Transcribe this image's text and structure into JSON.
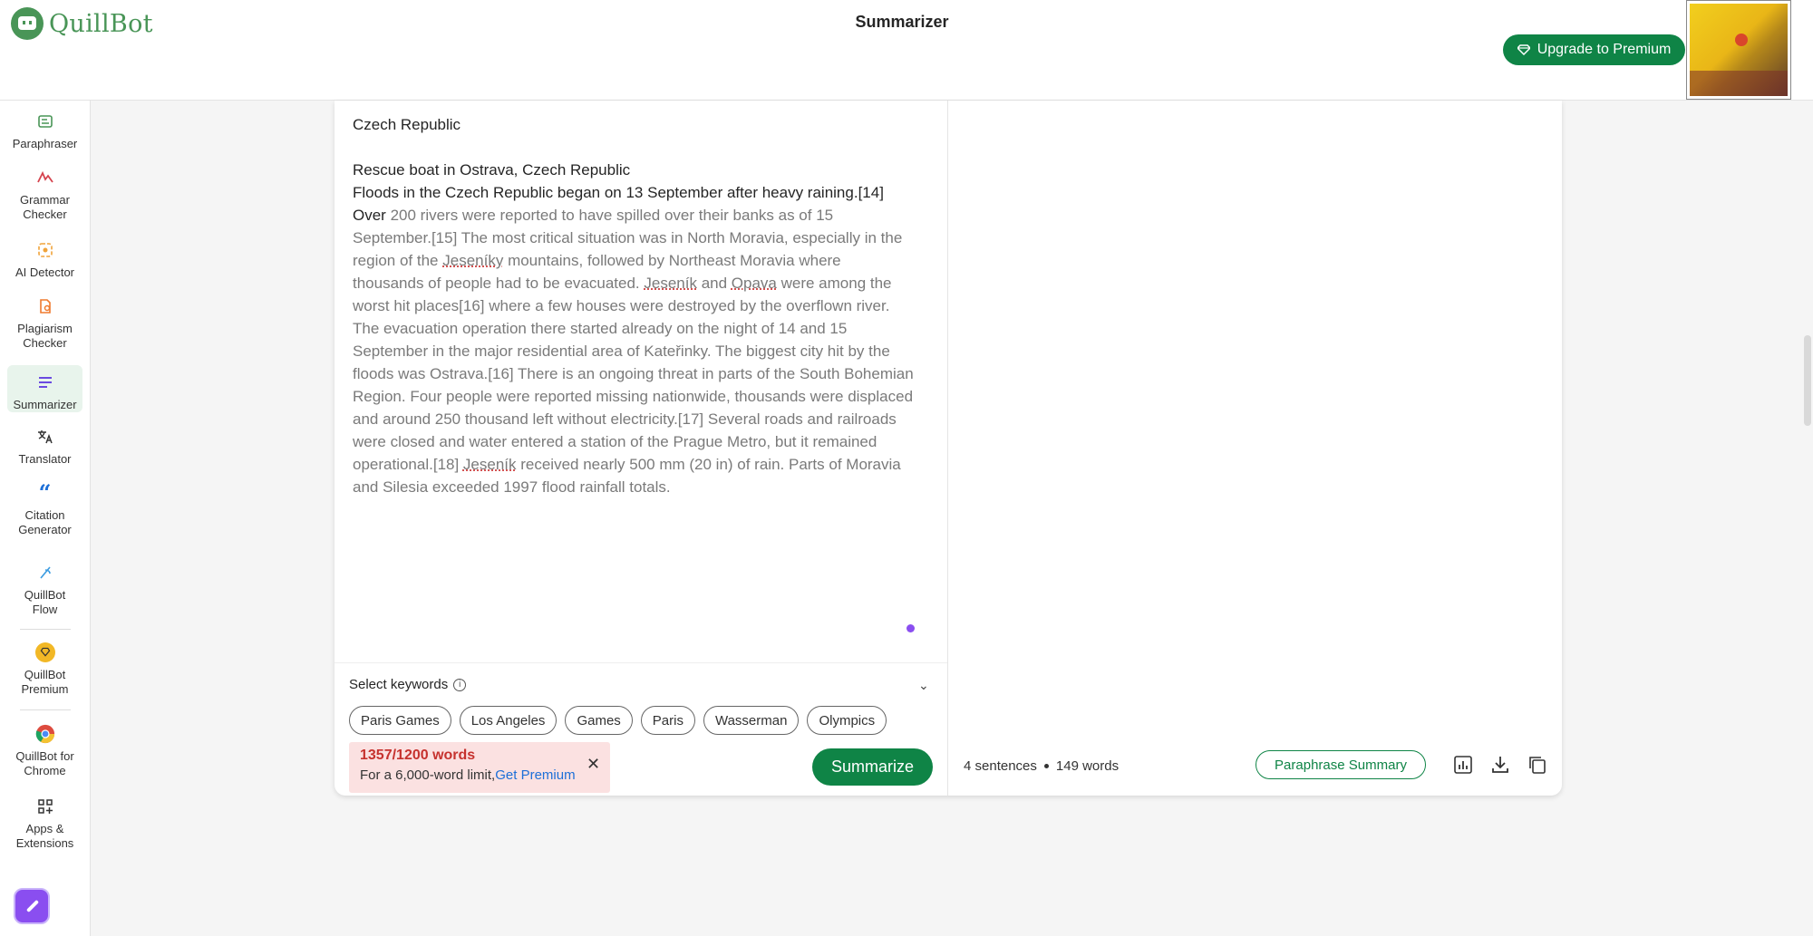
{
  "app": {
    "brand": "QuillBot",
    "page_title": "Summarizer",
    "upgrade_label": "Upgrade to Premium"
  },
  "sidebar": {
    "items": [
      {
        "label": "Paraphraser",
        "icon": "paraphraser-icon"
      },
      {
        "label": "Grammar Checker",
        "icon": "grammar-icon"
      },
      {
        "label": "AI Detector",
        "icon": "ai-detector-icon"
      },
      {
        "label": "Plagiarism Checker",
        "icon": "plagiarism-icon"
      },
      {
        "label": "Summarizer",
        "icon": "summarizer-icon"
      },
      {
        "label": "Translator",
        "icon": "translator-icon"
      },
      {
        "label": "Citation Generator",
        "icon": "citation-icon"
      },
      {
        "label": "QuillBot Flow",
        "icon": "flow-icon"
      },
      {
        "label": "QuillBot Premium",
        "icon": "premium-icon"
      },
      {
        "label": "QuillBot for Chrome",
        "icon": "chrome-icon"
      },
      {
        "label": "Apps & Extensions",
        "icon": "apps-icon"
      }
    ]
  },
  "input": {
    "heading": "Czech Republic",
    "line1": "Rescue boat in Ostrava, Czech Republic",
    "line2": "Floods in the Czech Republic began on 13 September after heavy raining.[14]",
    "over": "Over",
    "p1": " 200 rivers were reported to have spilled over their banks as of 15 September.[15] The most critical situation was in North Moravia, especially in the region of the ",
    "w_jesenikyo": "Jeseníky",
    "p2": " mountains, followed by Northeast Moravia where thousands of people had to be evacuated. ",
    "w_jesenik1": "Jeseník",
    "p3": " and ",
    "w_opava": "Opava",
    "p4": " were among the worst hit places[16] where a few houses were destroyed by the overflown river. The evacuation operation there started already on the night of 14 and 15 September in the major residential area of Kateřinky. The biggest city hit by the floods was Ostrava.[16] There is an ongoing threat in parts of the South Bohemian Region. Four people were reported missing nationwide, thousands were displaced and around 250 thousand left without electricity.[17] Several roads and railroads were closed and water entered a station of the Prague Metro, but it remained operational.[18] ",
    "w_jesenik2": "Jeseník",
    "p5": " received nearly 500 mm (20 in) of rain. Parts of Moravia and Silesia exceeded 1997 flood rainfall totals."
  },
  "keywords": {
    "label": "Select keywords",
    "chips": [
      "Paris Games",
      "Los Angeles",
      "Games",
      "Paris",
      "Wasserman",
      "Olympics"
    ]
  },
  "limit": {
    "title": "1357/1200 words",
    "text": "For a 6,000-word limit,",
    "link": "Get Premium"
  },
  "actions": {
    "summarize": "Summarize",
    "paraphrase_summary": "Paraphrase Summary"
  },
  "output": {
    "sentences": "4 sentences",
    "words": "149 words"
  },
  "colors": {
    "brand_green": "#0f8446",
    "accent_purple": "#8a4ef0",
    "error_red": "#c6322e"
  }
}
